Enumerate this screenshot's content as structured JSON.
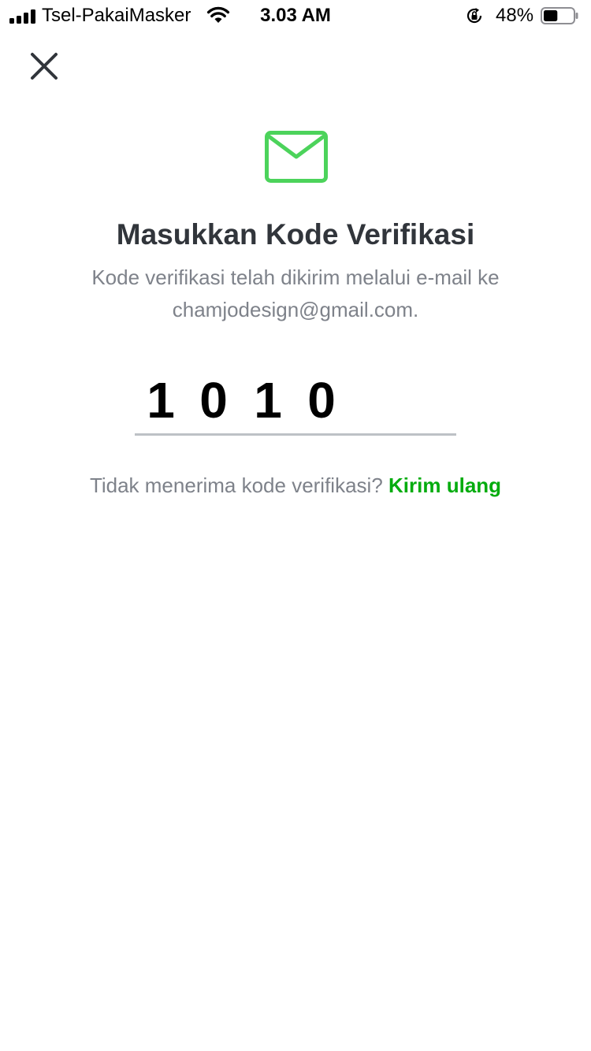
{
  "status_bar": {
    "carrier": "Tsel-PakaiMasker",
    "time": "3.03 AM",
    "battery_percent": "48%",
    "battery_level": 0.48,
    "icons": [
      "signal-icon",
      "wifi-icon",
      "rotation-lock-icon",
      "battery-icon"
    ]
  },
  "header": {
    "close_icon": "close-icon"
  },
  "verification": {
    "icon": "mail-icon",
    "title": "Masukkan Kode Verifikasi",
    "subtitle": "Kode verifikasi telah dikirim melalui e-mail ke chamjodesign@gmail.com.",
    "code_digits": [
      "1",
      "0",
      "1",
      "0"
    ],
    "resend_prompt": "Tidak menerima kode verifikasi?",
    "resend_link": "Kirim ulang"
  },
  "colors": {
    "accent_green": "#03ac0e",
    "mail_icon_green": "#4cd35b",
    "title_text": "#31353b",
    "secondary_text": "#7e828a",
    "underline": "#bdc1c6"
  }
}
